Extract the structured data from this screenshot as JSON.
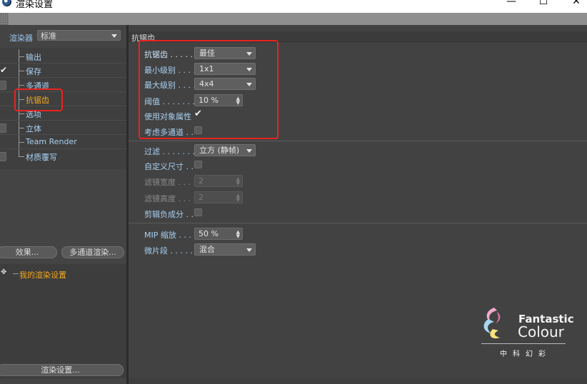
{
  "window": {
    "title": "渲染设置",
    "minimize": "—",
    "maximize": "☐",
    "close": "✕"
  },
  "left": {
    "renderer_label": "渲染器",
    "renderer_value": "标准",
    "tree": [
      {
        "label": "输出",
        "checkbox": false,
        "checked": false,
        "active": false
      },
      {
        "label": "保存",
        "checkbox": false,
        "checked": true,
        "active": false
      },
      {
        "label": "多通道",
        "checkbox": true,
        "checked": false,
        "active": false
      },
      {
        "label": "抗锯齿",
        "checkbox": false,
        "checked": false,
        "active": true
      },
      {
        "label": "选项",
        "checkbox": false,
        "checked": false,
        "active": false
      },
      {
        "label": "立体",
        "checkbox": true,
        "checked": false,
        "active": false
      },
      {
        "label": "Team Render",
        "checkbox": false,
        "checked": false,
        "active": false
      },
      {
        "label": "材质覆写",
        "checkbox": true,
        "checked": false,
        "active": false
      }
    ],
    "effects_button": "效果...",
    "multipass_button": "多通道渲染...",
    "settings_item": "我的渲染设置",
    "render_settings_button": "渲染设置..."
  },
  "main": {
    "section_title": "抗锯齿",
    "group1": {
      "antialiasing": {
        "label": "抗锯齿 . . . . . .",
        "value": "最佳"
      },
      "min_level": {
        "label": "最小级别 . . . .",
        "value": "1x1"
      },
      "max_level": {
        "label": "最大级别 . . . .",
        "value": "4x4"
      },
      "threshold": {
        "label": "阈值 . . . . . . . .",
        "value": "10 %"
      },
      "use_object_props": {
        "label": "使用对象属性",
        "checked": true
      },
      "consider_multipass": {
        "label": "考虑多通道 . .",
        "checked": false
      }
    },
    "group2": {
      "filter": {
        "label": "过滤 . . . . . . . .",
        "value": "立方 (静帧)"
      },
      "custom_size": {
        "label": "自定义尺寸 . .",
        "checked": false
      },
      "filter_width": {
        "label": "滤镜宽度 . . . .",
        "value": "2"
      },
      "filter_height": {
        "label": "滤镜高度 . . . .",
        "value": "2"
      },
      "clip_negative": {
        "label": "剪辑负成分 . .",
        "checked": false
      }
    },
    "group3": {
      "mip_scale": {
        "label": "MIP 缩放 . . . .",
        "value": "50 %"
      },
      "micropolygon": {
        "label": "微片段 . . . . . .",
        "value": "混合"
      }
    }
  },
  "logo": {
    "line1": "Fantastic",
    "line2": "Colour",
    "chinese": "中科幻彩"
  },
  "colors": {
    "accent_label": "#a9d0f2",
    "active_orange": "#f4a81d",
    "highlight_red": "#e8231f",
    "panel_bg": "#424242"
  }
}
